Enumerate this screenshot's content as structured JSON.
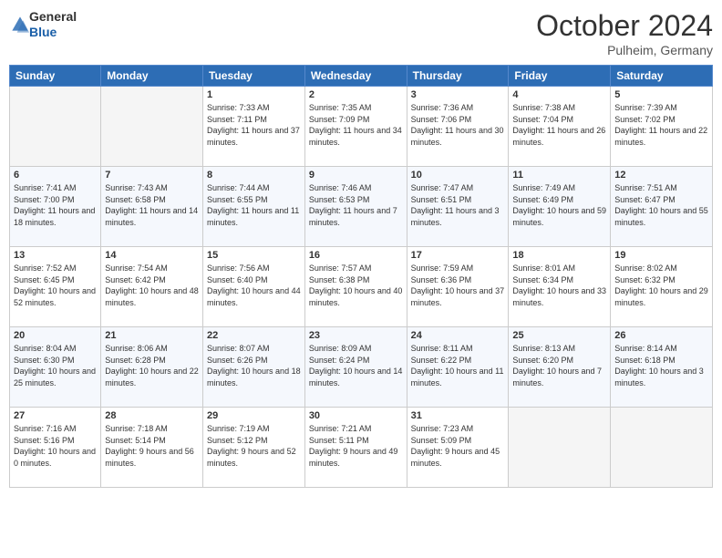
{
  "header": {
    "logo": {
      "general": "General",
      "blue": "Blue"
    },
    "title": "October 2024",
    "location": "Pulheim, Germany"
  },
  "weekdays": [
    "Sunday",
    "Monday",
    "Tuesday",
    "Wednesday",
    "Thursday",
    "Friday",
    "Saturday"
  ],
  "weeks": [
    [
      {
        "day": "",
        "empty": true
      },
      {
        "day": "",
        "empty": true
      },
      {
        "day": "1",
        "sunrise": "Sunrise: 7:33 AM",
        "sunset": "Sunset: 7:11 PM",
        "daylight": "Daylight: 11 hours and 37 minutes."
      },
      {
        "day": "2",
        "sunrise": "Sunrise: 7:35 AM",
        "sunset": "Sunset: 7:09 PM",
        "daylight": "Daylight: 11 hours and 34 minutes."
      },
      {
        "day": "3",
        "sunrise": "Sunrise: 7:36 AM",
        "sunset": "Sunset: 7:06 PM",
        "daylight": "Daylight: 11 hours and 30 minutes."
      },
      {
        "day": "4",
        "sunrise": "Sunrise: 7:38 AM",
        "sunset": "Sunset: 7:04 PM",
        "daylight": "Daylight: 11 hours and 26 minutes."
      },
      {
        "day": "5",
        "sunrise": "Sunrise: 7:39 AM",
        "sunset": "Sunset: 7:02 PM",
        "daylight": "Daylight: 11 hours and 22 minutes."
      }
    ],
    [
      {
        "day": "6",
        "sunrise": "Sunrise: 7:41 AM",
        "sunset": "Sunset: 7:00 PM",
        "daylight": "Daylight: 11 hours and 18 minutes."
      },
      {
        "day": "7",
        "sunrise": "Sunrise: 7:43 AM",
        "sunset": "Sunset: 6:58 PM",
        "daylight": "Daylight: 11 hours and 14 minutes."
      },
      {
        "day": "8",
        "sunrise": "Sunrise: 7:44 AM",
        "sunset": "Sunset: 6:55 PM",
        "daylight": "Daylight: 11 hours and 11 minutes."
      },
      {
        "day": "9",
        "sunrise": "Sunrise: 7:46 AM",
        "sunset": "Sunset: 6:53 PM",
        "daylight": "Daylight: 11 hours and 7 minutes."
      },
      {
        "day": "10",
        "sunrise": "Sunrise: 7:47 AM",
        "sunset": "Sunset: 6:51 PM",
        "daylight": "Daylight: 11 hours and 3 minutes."
      },
      {
        "day": "11",
        "sunrise": "Sunrise: 7:49 AM",
        "sunset": "Sunset: 6:49 PM",
        "daylight": "Daylight: 10 hours and 59 minutes."
      },
      {
        "day": "12",
        "sunrise": "Sunrise: 7:51 AM",
        "sunset": "Sunset: 6:47 PM",
        "daylight": "Daylight: 10 hours and 55 minutes."
      }
    ],
    [
      {
        "day": "13",
        "sunrise": "Sunrise: 7:52 AM",
        "sunset": "Sunset: 6:45 PM",
        "daylight": "Daylight: 10 hours and 52 minutes."
      },
      {
        "day": "14",
        "sunrise": "Sunrise: 7:54 AM",
        "sunset": "Sunset: 6:42 PM",
        "daylight": "Daylight: 10 hours and 48 minutes."
      },
      {
        "day": "15",
        "sunrise": "Sunrise: 7:56 AM",
        "sunset": "Sunset: 6:40 PM",
        "daylight": "Daylight: 10 hours and 44 minutes."
      },
      {
        "day": "16",
        "sunrise": "Sunrise: 7:57 AM",
        "sunset": "Sunset: 6:38 PM",
        "daylight": "Daylight: 10 hours and 40 minutes."
      },
      {
        "day": "17",
        "sunrise": "Sunrise: 7:59 AM",
        "sunset": "Sunset: 6:36 PM",
        "daylight": "Daylight: 10 hours and 37 minutes."
      },
      {
        "day": "18",
        "sunrise": "Sunrise: 8:01 AM",
        "sunset": "Sunset: 6:34 PM",
        "daylight": "Daylight: 10 hours and 33 minutes."
      },
      {
        "day": "19",
        "sunrise": "Sunrise: 8:02 AM",
        "sunset": "Sunset: 6:32 PM",
        "daylight": "Daylight: 10 hours and 29 minutes."
      }
    ],
    [
      {
        "day": "20",
        "sunrise": "Sunrise: 8:04 AM",
        "sunset": "Sunset: 6:30 PM",
        "daylight": "Daylight: 10 hours and 25 minutes."
      },
      {
        "day": "21",
        "sunrise": "Sunrise: 8:06 AM",
        "sunset": "Sunset: 6:28 PM",
        "daylight": "Daylight: 10 hours and 22 minutes."
      },
      {
        "day": "22",
        "sunrise": "Sunrise: 8:07 AM",
        "sunset": "Sunset: 6:26 PM",
        "daylight": "Daylight: 10 hours and 18 minutes."
      },
      {
        "day": "23",
        "sunrise": "Sunrise: 8:09 AM",
        "sunset": "Sunset: 6:24 PM",
        "daylight": "Daylight: 10 hours and 14 minutes."
      },
      {
        "day": "24",
        "sunrise": "Sunrise: 8:11 AM",
        "sunset": "Sunset: 6:22 PM",
        "daylight": "Daylight: 10 hours and 11 minutes."
      },
      {
        "day": "25",
        "sunrise": "Sunrise: 8:13 AM",
        "sunset": "Sunset: 6:20 PM",
        "daylight": "Daylight: 10 hours and 7 minutes."
      },
      {
        "day": "26",
        "sunrise": "Sunrise: 8:14 AM",
        "sunset": "Sunset: 6:18 PM",
        "daylight": "Daylight: 10 hours and 3 minutes."
      }
    ],
    [
      {
        "day": "27",
        "sunrise": "Sunrise: 7:16 AM",
        "sunset": "Sunset: 5:16 PM",
        "daylight": "Daylight: 10 hours and 0 minutes."
      },
      {
        "day": "28",
        "sunrise": "Sunrise: 7:18 AM",
        "sunset": "Sunset: 5:14 PM",
        "daylight": "Daylight: 9 hours and 56 minutes."
      },
      {
        "day": "29",
        "sunrise": "Sunrise: 7:19 AM",
        "sunset": "Sunset: 5:12 PM",
        "daylight": "Daylight: 9 hours and 52 minutes."
      },
      {
        "day": "30",
        "sunrise": "Sunrise: 7:21 AM",
        "sunset": "Sunset: 5:11 PM",
        "daylight": "Daylight: 9 hours and 49 minutes."
      },
      {
        "day": "31",
        "sunrise": "Sunrise: 7:23 AM",
        "sunset": "Sunset: 5:09 PM",
        "daylight": "Daylight: 9 hours and 45 minutes."
      },
      {
        "day": "",
        "empty": true
      },
      {
        "day": "",
        "empty": true
      }
    ]
  ]
}
